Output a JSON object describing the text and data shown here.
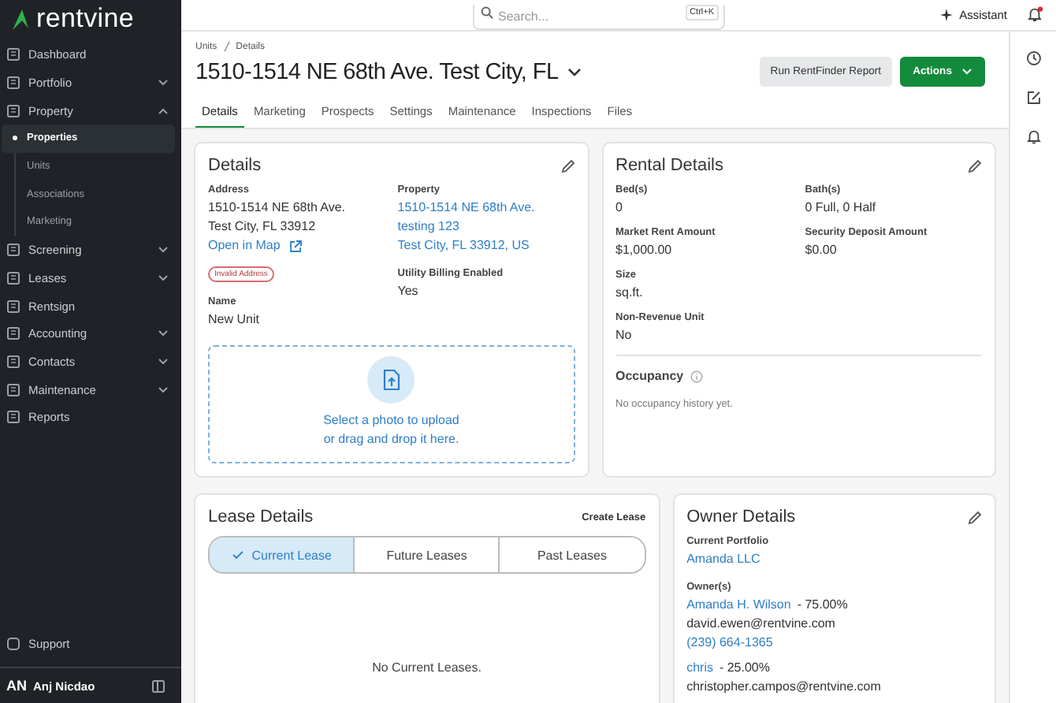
{
  "sidebar": {
    "logo": "rentvine",
    "items": [
      {
        "label": "Dashboard"
      },
      {
        "label": "Portfolio",
        "expanded": false
      },
      {
        "label": "Property",
        "expanded": true,
        "children": [
          {
            "label": "Properties",
            "selected": true
          },
          {
            "label": "Units",
            "selected": false
          },
          {
            "label": "Associations",
            "selected": false
          },
          {
            "label": "Marketing",
            "selected": false
          }
        ]
      },
      {
        "label": "Screening",
        "expanded": false
      },
      {
        "label": "Leases",
        "expanded": false
      },
      {
        "label": "Rentsign"
      },
      {
        "label": "Accounting",
        "expanded": false
      },
      {
        "label": "Contacts",
        "expanded": false
      },
      {
        "label": "Maintenance",
        "expanded": false
      },
      {
        "label": "Reports"
      }
    ],
    "support": "Support",
    "user": {
      "initials": "AN",
      "name": "Anj Nicdao"
    }
  },
  "topbar": {
    "search": {
      "placeholder": "Search...",
      "shortcut": "Ctrl+K"
    },
    "assistant": "Assistant",
    "notifications_unread": true
  },
  "header": {
    "breadcrumbs": [
      "Units",
      "Details"
    ],
    "title": "1510-1514 NE 68th Ave. Test City, FL",
    "buttons": [
      {
        "label": "Run RentFinder Report",
        "kind": "secondary"
      },
      {
        "label": "Actions",
        "kind": "primary"
      }
    ],
    "tabs": [
      {
        "label": "Details",
        "selected": true
      },
      {
        "label": "Marketing",
        "selected": false
      },
      {
        "label": "Prospects",
        "selected": false
      },
      {
        "label": "Settings",
        "selected": false
      },
      {
        "label": "Maintenance",
        "selected": false
      },
      {
        "label": "Inspections",
        "selected": false
      },
      {
        "label": "Files",
        "selected": false
      }
    ]
  },
  "details": {
    "title": "Details",
    "address": {
      "label": "Address",
      "lines": [
        "1510-1514 NE 68th Ave.",
        "Test City, FL 33912"
      ],
      "map_link": "Open in Map",
      "badge": "Invalid Address"
    },
    "name": {
      "label": "Name",
      "value": "New Unit"
    },
    "property": {
      "label": "Property",
      "links": [
        "1510-1514 NE 68th Ave.",
        "testing 123",
        "Test City, FL 33912, US"
      ]
    },
    "utility_billing": {
      "label": "Utility Billing Enabled",
      "value": "Yes"
    },
    "upload": [
      "Select a photo to upload",
      "or drag and drop it here."
    ]
  },
  "rental_details": {
    "title": "Rental Details",
    "rows": [
      [
        {
          "label": "Bed(s)",
          "value": "0"
        },
        {
          "label": "Bath(s)",
          "value": "0 Full, 0 Half"
        }
      ],
      [
        {
          "label": "Market Rent Amount",
          "value": "$1,000.00"
        },
        {
          "label": "Security Deposit Amount",
          "value": "$0.00"
        }
      ],
      [
        {
          "label": "Size",
          "value": "sq.ft."
        }
      ],
      [
        {
          "label": "Non-Revenue Unit",
          "value": "No"
        }
      ]
    ],
    "occupancy": {
      "title": "Occupancy",
      "empty": "No occupancy history yet."
    }
  },
  "lease_details": {
    "title": "Lease Details",
    "action": "Create Lease",
    "segments": [
      {
        "label": "Current Lease",
        "selected": true
      },
      {
        "label": "Future Leases",
        "selected": false
      },
      {
        "label": "Past Leases",
        "selected": false
      }
    ],
    "empty": "No Current Leases."
  },
  "owner_details": {
    "title": "Owner Details",
    "portfolio_label": "Current Portfolio",
    "portfolio": "Amanda LLC",
    "owners_label": "Owner(s)",
    "owners": [
      {
        "name": "Amanda H. Wilson",
        "share": "- 75.00%",
        "email": "david.ewen@rentvine.com",
        "phone": "(239) 664-1365"
      },
      {
        "name": "chris",
        "share": "- 25.00%",
        "email": "christopher.campos@rentvine.com"
      }
    ]
  }
}
